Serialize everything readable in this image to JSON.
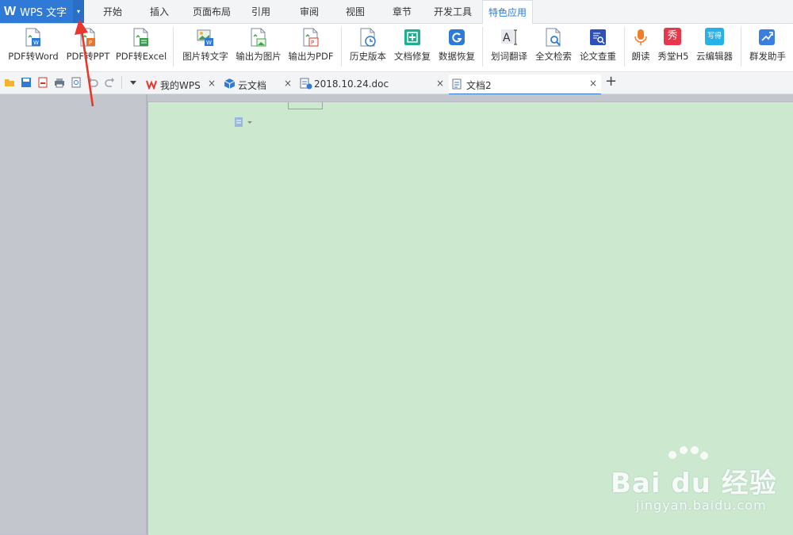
{
  "app": {
    "logo": "W",
    "title": "WPS 文字",
    "dropdown": "▾"
  },
  "menu_tabs": [
    {
      "label": "开始"
    },
    {
      "label": "插入"
    },
    {
      "label": "页面布局"
    },
    {
      "label": "引用"
    },
    {
      "label": "审阅"
    },
    {
      "label": "视图"
    },
    {
      "label": "章节"
    },
    {
      "label": "开发工具"
    },
    {
      "label": "特色应用",
      "active": true
    }
  ],
  "ribbon": [
    {
      "label": "PDF转Word",
      "icon": "pdf-to-word-icon"
    },
    {
      "label": "PDF转PPT",
      "icon": "pdf-to-ppt-icon"
    },
    {
      "label": "PDF转Excel",
      "icon": "pdf-to-excel-icon"
    },
    {
      "label": "图片转文字",
      "icon": "image-to-text-icon"
    },
    {
      "label": "输出为图片",
      "icon": "export-image-icon"
    },
    {
      "label": "输出为PDF",
      "icon": "export-pdf-icon"
    },
    {
      "label": "历史版本",
      "icon": "history-icon"
    },
    {
      "label": "文档修复",
      "icon": "doc-repair-icon"
    },
    {
      "label": "数据恢复",
      "icon": "data-recovery-icon"
    },
    {
      "label": "划词翻译",
      "icon": "translate-icon"
    },
    {
      "label": "全文检索",
      "icon": "fulltext-search-icon"
    },
    {
      "label": "论文查重",
      "icon": "plagiarism-check-icon"
    },
    {
      "label": "朗读",
      "icon": "read-aloud-icon"
    },
    {
      "label": "秀堂H5",
      "icon": "xiutang-icon",
      "badge": "秀"
    },
    {
      "label": "云编辑器",
      "icon": "cloud-editor-icon",
      "badge": "写得"
    },
    {
      "label": "群发助手",
      "icon": "mass-send-icon"
    }
  ],
  "doc_tabs": [
    {
      "label": "我的WPS"
    },
    {
      "label": "云文档"
    },
    {
      "label": "2018.10.24.doc"
    },
    {
      "label": "文档2",
      "active": true
    }
  ],
  "close_glyph": "×",
  "new_tab_glyph": "+",
  "watermark": {
    "brand": "Bai du 经验",
    "url": "jingyan.baidu.com"
  },
  "colors": {
    "accent": "#2f7ad7",
    "page": "#cce8cf",
    "arrow": "#e8372c"
  }
}
